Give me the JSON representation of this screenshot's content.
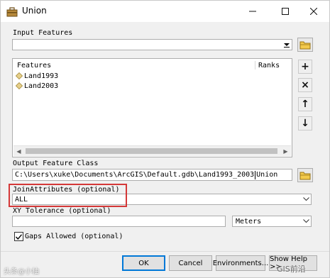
{
  "window": {
    "title": "Union"
  },
  "input_features": {
    "label": "Input Features",
    "value": "",
    "list": {
      "col_features": "Features",
      "col_ranks": "Ranks",
      "items": [
        {
          "name": "Land1993"
        },
        {
          "name": "Land2003"
        }
      ]
    }
  },
  "side_buttons": {
    "add": "+",
    "remove": "×",
    "up": "↑",
    "down": "↓"
  },
  "output": {
    "label": "Output Feature Class",
    "value_before_caret": "C:\\Users\\xuke\\Documents\\ArcGIS\\Default.gdb\\Land1993_2003",
    "value_after_caret": "Union"
  },
  "join_attributes": {
    "label": "JoinAttributes (optional)",
    "value": "ALL"
  },
  "xy_tolerance": {
    "label": "XY Tolerance (optional)",
    "value": "",
    "unit": "Meters"
  },
  "gaps": {
    "label": "Gaps Allowed (optional)",
    "checked": true
  },
  "buttons": {
    "ok": "OK",
    "cancel": "Cancel",
    "environments": "Environments...",
    "show_help": "Show Help >>"
  },
  "watermarks": {
    "left": "头条@小柚",
    "right": "GIS前沿"
  },
  "colors": {
    "highlight_border": "#d43838",
    "default_button_border": "#0078d7"
  }
}
